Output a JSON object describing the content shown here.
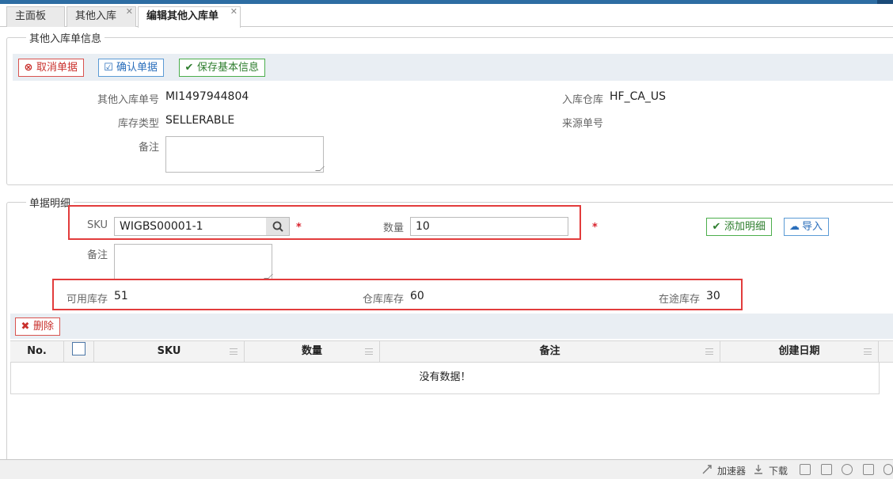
{
  "tabs": [
    {
      "label": "主面板"
    },
    {
      "label": "其他入库"
    },
    {
      "label": "编辑其他入库单"
    }
  ],
  "header_section": {
    "legend": "其他入库单信息",
    "buttons": {
      "cancel": "取消单据",
      "confirm": "确认单据",
      "save": "保存基本信息"
    },
    "fields": {
      "order_no_label": "其他入库单号",
      "order_no_value": "MI1497944804",
      "warehouse_label": "入库仓库",
      "warehouse_value": "HF_CA_US",
      "stock_type_label": "库存类型",
      "stock_type_value": "SELLERABLE",
      "source_no_label": "来源单号",
      "remark_label": "备注"
    }
  },
  "detail_section": {
    "legend": "单据明细",
    "sku_label": "SKU",
    "sku_value": "WIGBS00001-1",
    "qty_label": "数量",
    "qty_value": "10",
    "remark_label": "备注",
    "required_mark": "*",
    "add_button": "添加明细",
    "import_button": "导入",
    "available_label": "可用库存",
    "available_value": "51",
    "warehouse_stock_label": "仓库库存",
    "warehouse_stock_value": "60",
    "transit_label": "在途库存",
    "transit_value": "30",
    "delete_button": "删除"
  },
  "table": {
    "columns": [
      "No.",
      "SKU",
      "数量",
      "备注",
      "创建日期"
    ],
    "empty_text": "没有数据！"
  },
  "statusbar": {
    "accelerator": "加速器",
    "download": "下载"
  },
  "colors": {
    "highlight_box": "#e23c3c",
    "danger": "#c9302c",
    "primary": "#2a6ebb",
    "success": "#2d7d2d"
  }
}
